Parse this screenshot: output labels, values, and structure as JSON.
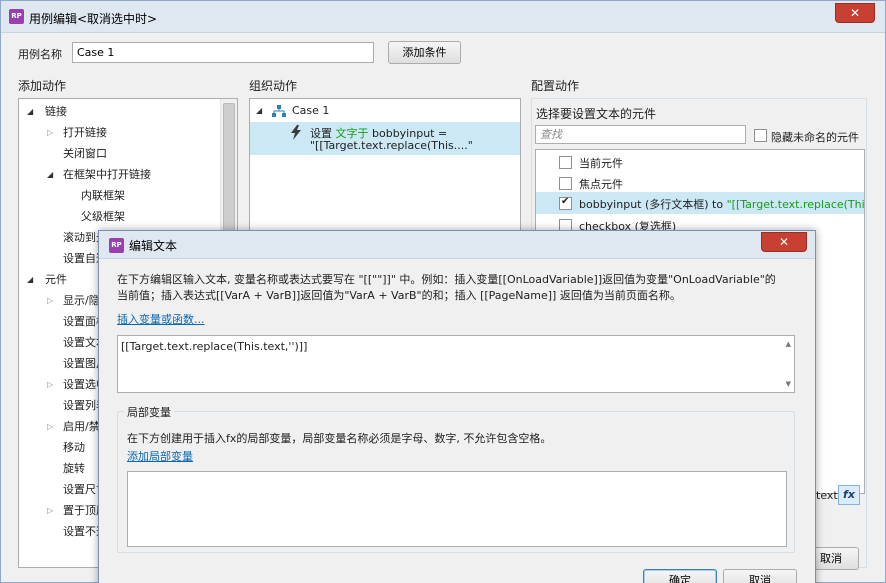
{
  "window": {
    "title": "用例编辑<取消选中时>",
    "logo": "RP",
    "close_icon": "✕"
  },
  "case_name": {
    "label": "用例名称",
    "value": "Case 1",
    "add_condition": "添加条件"
  },
  "add_actions": {
    "heading": "添加动作",
    "items": [
      {
        "label": "链接",
        "arrow": "◢"
      },
      {
        "label": "打开链接",
        "arrow": "▷"
      },
      {
        "label": "关闭窗口",
        "arrow": ""
      },
      {
        "label": "在框架中打开链接",
        "arrow": "◢"
      },
      {
        "label": "内联框架",
        "arrow": ""
      },
      {
        "label": "父级框架",
        "arrow": ""
      },
      {
        "label": "滚动到元",
        "arrow": ""
      },
      {
        "label": "设置自适",
        "arrow": ""
      },
      {
        "label": "元件",
        "arrow": "◢"
      },
      {
        "label": "显示/隐藏",
        "arrow": "▷"
      },
      {
        "label": "设置面板",
        "arrow": ""
      },
      {
        "label": "设置文本",
        "arrow": ""
      },
      {
        "label": "设置图片",
        "arrow": ""
      },
      {
        "label": "设置选中",
        "arrow": "▷"
      },
      {
        "label": "设置列表",
        "arrow": ""
      },
      {
        "label": "启用/禁用",
        "arrow": "▷"
      },
      {
        "label": "移动",
        "arrow": ""
      },
      {
        "label": "旋转",
        "arrow": ""
      },
      {
        "label": "设置尺寸",
        "arrow": ""
      },
      {
        "label": "置于顶层",
        "arrow": "▷"
      },
      {
        "label": "设置不透",
        "arrow": ""
      }
    ]
  },
  "organize_actions": {
    "heading": "组织动作",
    "case_label": "Case 1",
    "case_arrow": "◢",
    "action_prefix": "设置",
    "action_green": "文字于",
    "action_rest": "bobbyinput =",
    "action_line2": "\"[[Target.text.replace(This....\""
  },
  "config_actions": {
    "heading": "配置动作",
    "subheading": "选择要设置文本的元件",
    "search_placeholder": "查找",
    "hide_unnamed": "隐藏未命名的元件",
    "widgets": [
      {
        "label": "当前元件",
        "checked": false,
        "value": ""
      },
      {
        "label": "焦点元件",
        "checked": false,
        "value": ""
      },
      {
        "label": "bobbyinput (多行文本框) to",
        "checked": true,
        "value": "\"[[Target.text.replace(This....\""
      },
      {
        "label": "checkbox (复选框)",
        "checked": false,
        "value": ""
      }
    ],
    "value_fragment": "text",
    "fx_label": "fx"
  },
  "footer": {
    "cancel": "取消"
  },
  "edit_dialog": {
    "title": "编辑文本",
    "logo": "RP",
    "close_icon": "✕",
    "intro_line1": "在下方编辑区输入文本, 变量名称或表达式要写在 \"[[\"\"]]\" 中。例如：插入变量[[OnLoadVariable]]返回值为变量\"OnLoadVariable\"的",
    "intro_line2": "当前值；插入表达式[[VarA + VarB]]返回值为\"VarA + VarB\"的和；插入 [[PageName]] 返回值为当前页面名称。",
    "insert_link": "插入变量或函数...",
    "editor_value": "[[Target.text.replace(This.text,'')]]",
    "local_vars": {
      "title": "局部变量",
      "description": "在下方创建用于插入fx的局部变量，局部变量名称必须是字母、数字, 不允许包含空格。",
      "add_link": "添加局部变量"
    },
    "ok": "确定",
    "cancel": "取消"
  }
}
